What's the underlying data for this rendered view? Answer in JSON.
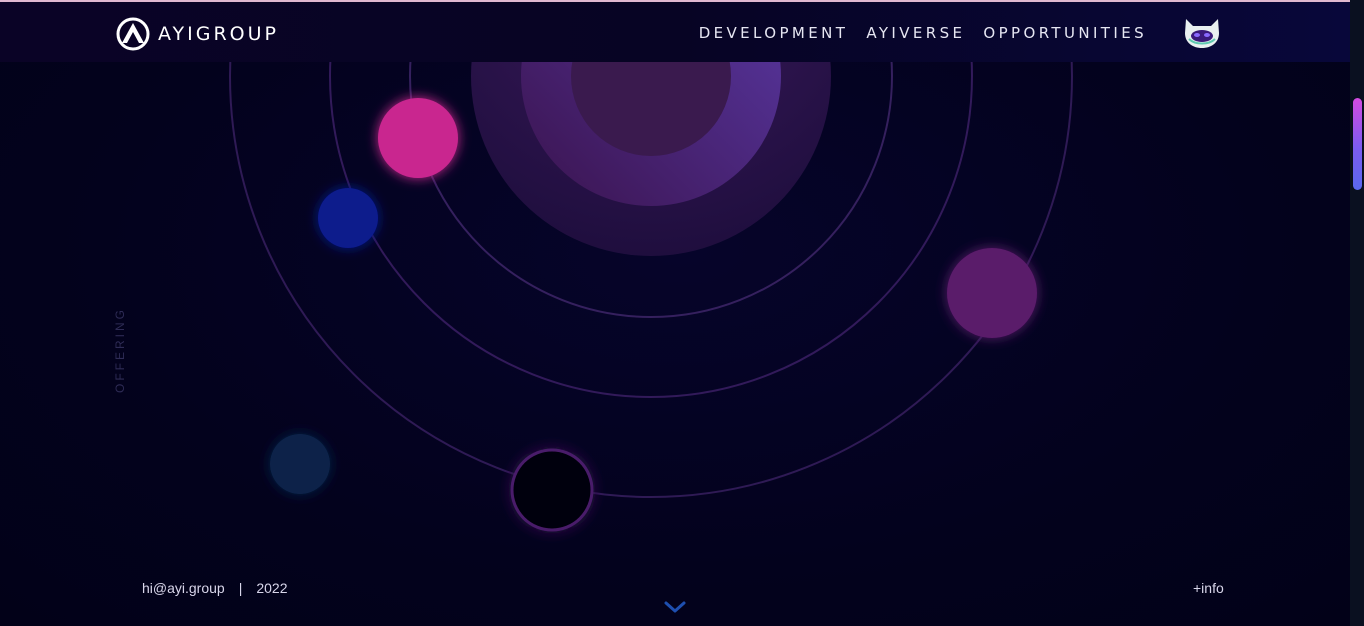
{
  "brand": {
    "name": "AYIGROUP",
    "logo_icon": "ayi-logo-icon"
  },
  "nav": {
    "items": [
      {
        "label": "DEVELOPMENT"
      },
      {
        "label": "AYIVERSE"
      },
      {
        "label": "OPPORTUNITIES"
      }
    ],
    "avatar_icon": "cat-mask-icon"
  },
  "hero": {
    "side_label": "OFFERING"
  },
  "footer": {
    "email": "hi@ayi.group",
    "separator": "|",
    "year": "2022",
    "info_label": "+info",
    "scroll_icon": "chevron-down-icon"
  },
  "colors": {
    "background": "#03021c",
    "accent_pink": "#c9278f",
    "accent_blue": "#0a1a8c",
    "accent_purple": "#5a1a6a",
    "scroll_thumb": "#b44ee6"
  }
}
